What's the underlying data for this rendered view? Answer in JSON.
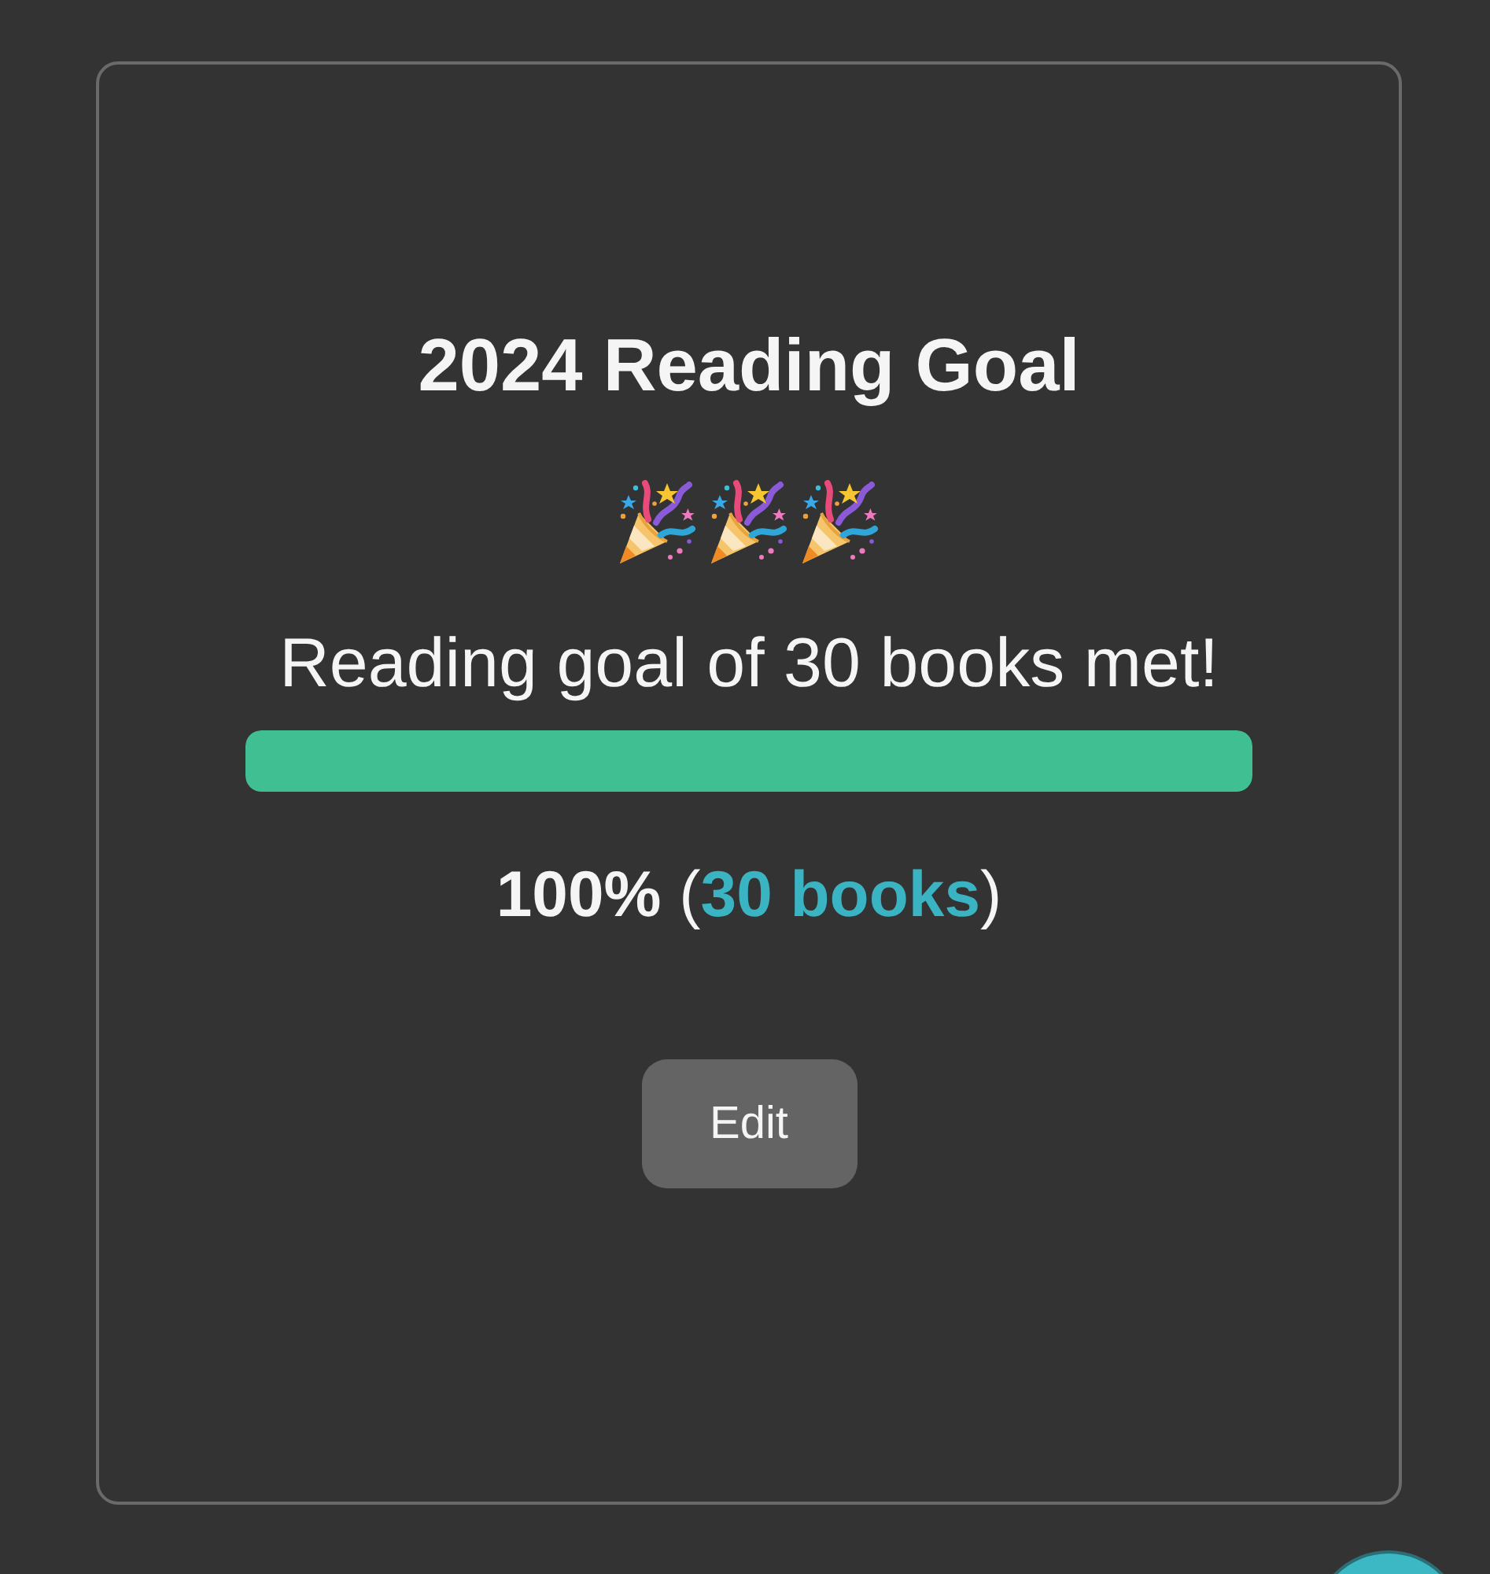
{
  "goal_card": {
    "title": "2024 Reading Goal",
    "message": "Reading goal of 30 books met!",
    "progress": {
      "level": 1
    },
    "summary": {
      "before": "**100%** (",
      "link": "30 books",
      "after": ")"
    },
    "edit_button": "Edit"
  }
}
